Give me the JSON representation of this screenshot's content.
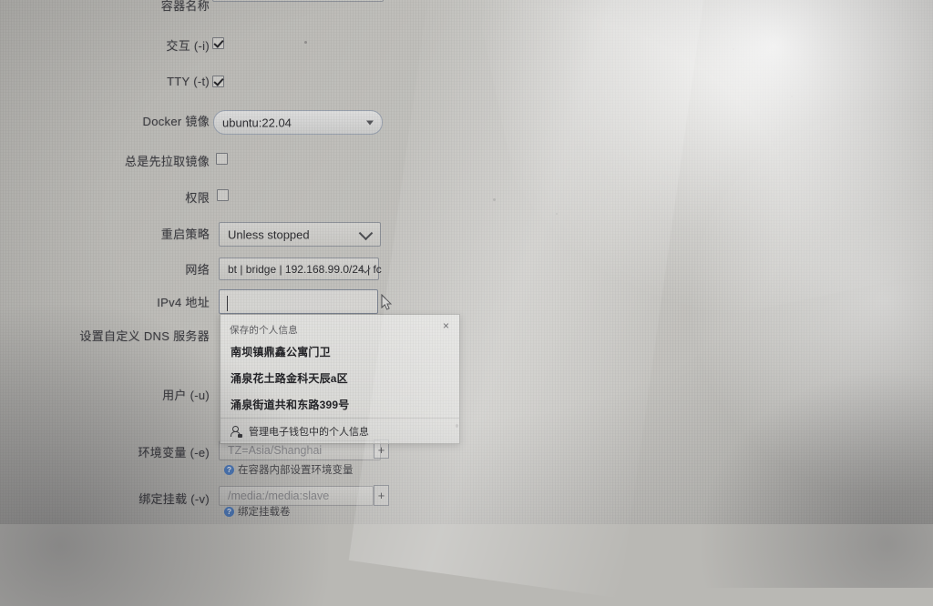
{
  "form": {
    "title_row_label": "容器名称",
    "rows": [
      {
        "label": "容器名称",
        "type": "text",
        "value": ""
      },
      {
        "label": "交互 (-i)",
        "type": "checkbox",
        "checked": true
      },
      {
        "label": "TTY (-t)",
        "type": "checkbox",
        "checked": true
      },
      {
        "label": "Docker 镜像",
        "type": "combobox",
        "value": "ubuntu:22.04"
      },
      {
        "label": "总是先拉取镜像",
        "type": "checkbox",
        "checked": false
      },
      {
        "label": "权限",
        "type": "checkbox",
        "checked": false
      },
      {
        "label": "重启策略",
        "type": "select",
        "value": "Unless stopped"
      },
      {
        "label": "网络",
        "type": "select",
        "value": "bt | bridge | 192.168.99.0/24 | fc"
      },
      {
        "label": "IPv4 地址",
        "type": "text",
        "value": ""
      },
      {
        "label": "设置自定义 DNS 服务器",
        "type": "text",
        "value": ""
      },
      {
        "label": "用户 (-u)",
        "type": "text",
        "value": ""
      },
      {
        "label": "环境变量 (-e)",
        "type": "text",
        "placeholder": "TZ=Asia/Shanghai",
        "add_label": "+",
        "hint": "在容器内部设置环境变量"
      },
      {
        "label": "绑定挂载 (-v)",
        "type": "text",
        "placeholder": "/media:/media:slave",
        "add_label": "+",
        "hint": "绑定挂载卷"
      }
    ]
  },
  "autofill": {
    "header": "保存的个人信息",
    "close_label": "×",
    "items": [
      "南坝镇鼎鑫公寓门卫",
      "涌泉花土路金科天辰a区",
      "涌泉街道共和东路399号"
    ],
    "manage_label": "管理电子钱包中的个人信息"
  },
  "colors": {
    "accent_help": "#4f7fc4",
    "field_border": "#8e9299",
    "text": "#2e2e32",
    "popup_bg": "#e9e9e7"
  }
}
